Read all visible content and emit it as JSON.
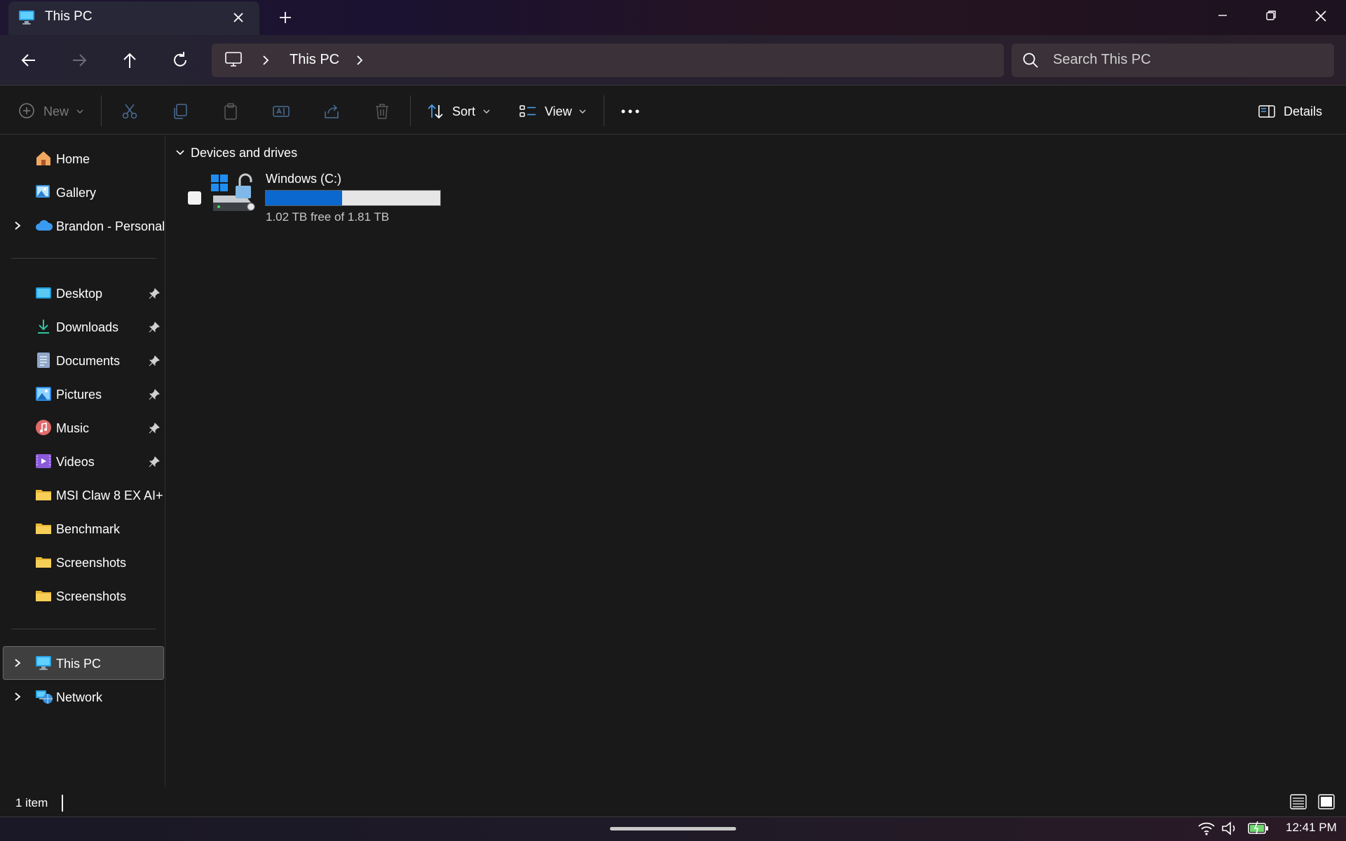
{
  "window": {
    "tab_title": "This PC",
    "new_tab_symbol": "+",
    "colors": {
      "accent": "#0a68cf",
      "background": "#191919",
      "selection": "#3f3f3f"
    }
  },
  "address_bar": {
    "crumbs": [
      "This PC"
    ],
    "search_placeholder": "Search This PC"
  },
  "command_bar": {
    "new_label": "New",
    "sort_label": "Sort",
    "view_label": "View",
    "details_label": "Details",
    "icons": [
      "cut-icon",
      "copy-icon",
      "paste-icon",
      "rename-icon",
      "share-icon",
      "delete-icon"
    ]
  },
  "sidebar": {
    "top_items": [
      {
        "label": "Home",
        "icon": "home-icon"
      },
      {
        "label": "Gallery",
        "icon": "gallery-icon"
      },
      {
        "label": "Brandon - Personal",
        "icon": "onedrive-cloud-icon",
        "expandable": true
      }
    ],
    "pinned_items": [
      {
        "label": "Desktop",
        "icon": "desktop-folder-icon",
        "pinned": true
      },
      {
        "label": "Downloads",
        "icon": "download-icon",
        "pinned": true
      },
      {
        "label": "Documents",
        "icon": "documents-icon",
        "pinned": true
      },
      {
        "label": "Pictures",
        "icon": "pictures-icon",
        "pinned": true
      },
      {
        "label": "Music",
        "icon": "music-icon",
        "pinned": true
      },
      {
        "label": "Videos",
        "icon": "videos-icon",
        "pinned": true
      },
      {
        "label": "MSI Claw 8 EX AI+",
        "icon": "folder-icon"
      },
      {
        "label": "Benchmark",
        "icon": "folder-icon"
      },
      {
        "label": "Screenshots",
        "icon": "folder-icon"
      },
      {
        "label": "Screenshots",
        "icon": "folder-icon"
      }
    ],
    "bottom_items": [
      {
        "label": "This PC",
        "icon": "this-pc-icon",
        "selected": true
      },
      {
        "label": "Network",
        "icon": "network-icon"
      }
    ]
  },
  "content": {
    "section_title": "Devices and drives",
    "drives": [
      {
        "name": "Windows (C:)",
        "free_text": "1.02 TB free of 1.81 TB",
        "used_fraction": 0.436
      }
    ]
  },
  "status_bar": {
    "item_count": "1 item"
  },
  "taskbar": {
    "clock": "12:41 PM"
  }
}
